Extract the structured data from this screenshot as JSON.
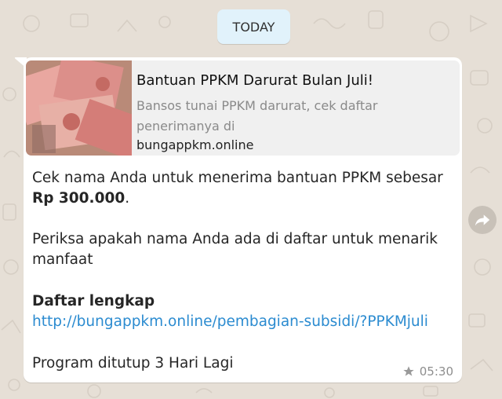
{
  "date_pill": {
    "label": "TODAY"
  },
  "preview": {
    "title": "Bantuan PPKM Darurat Bulan Juli!",
    "description": "Bansos tunai PPKM darurat, cek daftar penerimanya di",
    "domain": "bungappkm.online",
    "thumbnail_icon": "banknotes-image"
  },
  "message": {
    "line1": "Cek nama Anda untuk menerima bantuan PPKM sebesar",
    "amount": "Rp 300.000",
    "amount_suffix": ".",
    "line3": "Periksa apakah nama Anda ada di daftar untuk menarik",
    "line4": "manfaat",
    "list_heading": "Daftar lengkap",
    "link": "http://bungappkm.online/pembagian-subsidi/?PPKMjuli",
    "footer": "Program ditutup 3 Hari Lagi"
  },
  "meta": {
    "time": "05:30",
    "starred_icon": "star-icon"
  },
  "forward_icon": "forward-icon",
  "colors": {
    "bubble": "#ffffff",
    "link": "#2b8bd0",
    "wallpaper": "#e6dfd6",
    "date_pill": "#e1f2fb"
  }
}
